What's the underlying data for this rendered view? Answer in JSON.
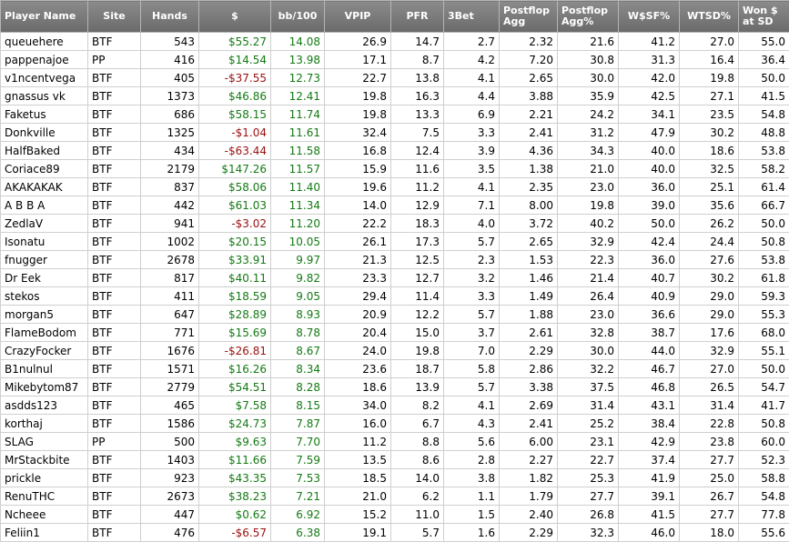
{
  "columns": [
    {
      "key": "name",
      "label": "Player Name",
      "cls": "left"
    },
    {
      "key": "site",
      "label": "Site",
      "cls": ""
    },
    {
      "key": "hands",
      "label": "Hands",
      "cls": ""
    },
    {
      "key": "money",
      "label": "$",
      "cls": ""
    },
    {
      "key": "bb100",
      "label": "bb/100",
      "cls": ""
    },
    {
      "key": "vpip",
      "label": "VPIP",
      "cls": ""
    },
    {
      "key": "pfr",
      "label": "PFR",
      "cls": ""
    },
    {
      "key": "threebet",
      "label": "3Bet",
      "cls": "left"
    },
    {
      "key": "pfagg",
      "label": "Postflop Agg",
      "cls": "wrap"
    },
    {
      "key": "pfaggpct",
      "label": "Postflop Agg%",
      "cls": "wrap"
    },
    {
      "key": "wsf",
      "label": "W$SF%",
      "cls": ""
    },
    {
      "key": "wtsd",
      "label": "WTSD%",
      "cls": ""
    },
    {
      "key": "wonsd",
      "label": "Won $ at SD",
      "cls": "wrap"
    }
  ],
  "rows": [
    {
      "name": "queuehere",
      "site": "BTF",
      "hands": "543",
      "money": "$55.27",
      "bb100": "14.08",
      "vpip": "26.9",
      "pfr": "14.7",
      "threebet": "2.7",
      "pfagg": "2.32",
      "pfaggpct": "21.6",
      "wsf": "41.2",
      "wtsd": "27.0",
      "wonsd": "55.0"
    },
    {
      "name": "pappenajoe",
      "site": "PP",
      "hands": "416",
      "money": "$14.54",
      "bb100": "13.98",
      "vpip": "17.1",
      "pfr": "8.7",
      "threebet": "4.2",
      "pfagg": "7.20",
      "pfaggpct": "30.8",
      "wsf": "31.3",
      "wtsd": "16.4",
      "wonsd": "36.4"
    },
    {
      "name": "v1ncentvega",
      "site": "BTF",
      "hands": "405",
      "money": "-$37.55",
      "bb100": "12.73",
      "vpip": "22.7",
      "pfr": "13.8",
      "threebet": "4.1",
      "pfagg": "2.65",
      "pfaggpct": "30.0",
      "wsf": "42.0",
      "wtsd": "19.8",
      "wonsd": "50.0"
    },
    {
      "name": "gnassus vk",
      "site": "BTF",
      "hands": "1373",
      "money": "$46.86",
      "bb100": "12.41",
      "vpip": "19.8",
      "pfr": "16.3",
      "threebet": "4.4",
      "pfagg": "3.88",
      "pfaggpct": "35.9",
      "wsf": "42.5",
      "wtsd": "27.1",
      "wonsd": "41.5"
    },
    {
      "name": "Faketus",
      "site": "BTF",
      "hands": "686",
      "money": "$58.15",
      "bb100": "11.74",
      "vpip": "19.8",
      "pfr": "13.3",
      "threebet": "6.9",
      "pfagg": "2.21",
      "pfaggpct": "24.2",
      "wsf": "34.1",
      "wtsd": "23.5",
      "wonsd": "54.8"
    },
    {
      "name": "Donkville",
      "site": "BTF",
      "hands": "1325",
      "money": "-$1.04",
      "bb100": "11.61",
      "vpip": "32.4",
      "pfr": "7.5",
      "threebet": "3.3",
      "pfagg": "2.41",
      "pfaggpct": "31.2",
      "wsf": "47.9",
      "wtsd": "30.2",
      "wonsd": "48.8"
    },
    {
      "name": "HalfBaked",
      "site": "BTF",
      "hands": "434",
      "money": "-$63.44",
      "bb100": "11.58",
      "vpip": "16.8",
      "pfr": "12.4",
      "threebet": "3.9",
      "pfagg": "4.36",
      "pfaggpct": "34.3",
      "wsf": "40.0",
      "wtsd": "18.6",
      "wonsd": "53.8"
    },
    {
      "name": "Coriace89",
      "site": "BTF",
      "hands": "2179",
      "money": "$147.26",
      "bb100": "11.57",
      "vpip": "15.9",
      "pfr": "11.6",
      "threebet": "3.5",
      "pfagg": "1.38",
      "pfaggpct": "21.0",
      "wsf": "40.0",
      "wtsd": "32.5",
      "wonsd": "58.2"
    },
    {
      "name": "AKAKAKAK",
      "site": "BTF",
      "hands": "837",
      "money": "$58.06",
      "bb100": "11.40",
      "vpip": "19.6",
      "pfr": "11.2",
      "threebet": "4.1",
      "pfagg": "2.35",
      "pfaggpct": "23.0",
      "wsf": "36.0",
      "wtsd": "25.1",
      "wonsd": "61.4"
    },
    {
      "name": "A B B A",
      "site": "BTF",
      "hands": "442",
      "money": "$61.03",
      "bb100": "11.34",
      "vpip": "14.0",
      "pfr": "12.9",
      "threebet": "7.1",
      "pfagg": "8.00",
      "pfaggpct": "19.8",
      "wsf": "39.0",
      "wtsd": "35.6",
      "wonsd": "66.7"
    },
    {
      "name": "ZedlaV",
      "site": "BTF",
      "hands": "941",
      "money": "-$3.02",
      "bb100": "11.20",
      "vpip": "22.2",
      "pfr": "18.3",
      "threebet": "4.0",
      "pfagg": "3.72",
      "pfaggpct": "40.2",
      "wsf": "50.0",
      "wtsd": "26.2",
      "wonsd": "50.0"
    },
    {
      "name": "Isonatu",
      "site": "BTF",
      "hands": "1002",
      "money": "$20.15",
      "bb100": "10.05",
      "vpip": "26.1",
      "pfr": "17.3",
      "threebet": "5.7",
      "pfagg": "2.65",
      "pfaggpct": "32.9",
      "wsf": "42.4",
      "wtsd": "24.4",
      "wonsd": "50.8"
    },
    {
      "name": "fnugger",
      "site": "BTF",
      "hands": "2678",
      "money": "$33.91",
      "bb100": "9.97",
      "vpip": "21.3",
      "pfr": "12.5",
      "threebet": "2.3",
      "pfagg": "1.53",
      "pfaggpct": "22.3",
      "wsf": "36.0",
      "wtsd": "27.6",
      "wonsd": "53.8"
    },
    {
      "name": "Dr Eek",
      "site": "BTF",
      "hands": "817",
      "money": "$40.11",
      "bb100": "9.82",
      "vpip": "23.3",
      "pfr": "12.7",
      "threebet": "3.2",
      "pfagg": "1.46",
      "pfaggpct": "21.4",
      "wsf": "40.7",
      "wtsd": "30.2",
      "wonsd": "61.8"
    },
    {
      "name": "stekos",
      "site": "BTF",
      "hands": "411",
      "money": "$18.59",
      "bb100": "9.05",
      "vpip": "29.4",
      "pfr": "11.4",
      "threebet": "3.3",
      "pfagg": "1.49",
      "pfaggpct": "26.4",
      "wsf": "40.9",
      "wtsd": "29.0",
      "wonsd": "59.3"
    },
    {
      "name": "morgan5",
      "site": "BTF",
      "hands": "647",
      "money": "$28.89",
      "bb100": "8.93",
      "vpip": "20.9",
      "pfr": "12.2",
      "threebet": "5.7",
      "pfagg": "1.88",
      "pfaggpct": "23.0",
      "wsf": "36.6",
      "wtsd": "29.0",
      "wonsd": "55.3"
    },
    {
      "name": "FlameBodom",
      "site": "BTF",
      "hands": "771",
      "money": "$15.69",
      "bb100": "8.78",
      "vpip": "20.4",
      "pfr": "15.0",
      "threebet": "3.7",
      "pfagg": "2.61",
      "pfaggpct": "32.8",
      "wsf": "38.7",
      "wtsd": "17.6",
      "wonsd": "68.0"
    },
    {
      "name": "CrazyFocker",
      "site": "BTF",
      "hands": "1676",
      "money": "-$26.81",
      "bb100": "8.67",
      "vpip": "24.0",
      "pfr": "19.8",
      "threebet": "7.0",
      "pfagg": "2.29",
      "pfaggpct": "30.0",
      "wsf": "44.0",
      "wtsd": "32.9",
      "wonsd": "55.1"
    },
    {
      "name": "B1nulnul",
      "site": "BTF",
      "hands": "1571",
      "money": "$16.26",
      "bb100": "8.34",
      "vpip": "23.6",
      "pfr": "18.7",
      "threebet": "5.8",
      "pfagg": "2.86",
      "pfaggpct": "32.2",
      "wsf": "46.7",
      "wtsd": "27.0",
      "wonsd": "50.0"
    },
    {
      "name": "Mikebytom87",
      "site": "BTF",
      "hands": "2779",
      "money": "$54.51",
      "bb100": "8.28",
      "vpip": "18.6",
      "pfr": "13.9",
      "threebet": "5.7",
      "pfagg": "3.38",
      "pfaggpct": "37.5",
      "wsf": "46.8",
      "wtsd": "26.5",
      "wonsd": "54.7"
    },
    {
      "name": "asdds123",
      "site": "BTF",
      "hands": "465",
      "money": "$7.58",
      "bb100": "8.15",
      "vpip": "34.0",
      "pfr": "8.2",
      "threebet": "4.1",
      "pfagg": "2.69",
      "pfaggpct": "31.4",
      "wsf": "43.1",
      "wtsd": "31.4",
      "wonsd": "41.7"
    },
    {
      "name": "korthaj",
      "site": "BTF",
      "hands": "1586",
      "money": "$24.73",
      "bb100": "7.87",
      "vpip": "16.0",
      "pfr": "6.7",
      "threebet": "4.3",
      "pfagg": "2.41",
      "pfaggpct": "25.2",
      "wsf": "38.4",
      "wtsd": "22.8",
      "wonsd": "50.8"
    },
    {
      "name": "SLAG",
      "site": "PP",
      "hands": "500",
      "money": "$9.63",
      "bb100": "7.70",
      "vpip": "11.2",
      "pfr": "8.8",
      "threebet": "5.6",
      "pfagg": "6.00",
      "pfaggpct": "23.1",
      "wsf": "42.9",
      "wtsd": "23.8",
      "wonsd": "60.0"
    },
    {
      "name": "MrStackbite",
      "site": "BTF",
      "hands": "1403",
      "money": "$11.66",
      "bb100": "7.59",
      "vpip": "13.5",
      "pfr": "8.6",
      "threebet": "2.8",
      "pfagg": "2.27",
      "pfaggpct": "22.7",
      "wsf": "37.4",
      "wtsd": "27.7",
      "wonsd": "52.3"
    },
    {
      "name": "prickle",
      "site": "BTF",
      "hands": "923",
      "money": "$43.35",
      "bb100": "7.53",
      "vpip": "18.5",
      "pfr": "14.0",
      "threebet": "3.8",
      "pfagg": "1.82",
      "pfaggpct": "25.3",
      "wsf": "41.9",
      "wtsd": "25.0",
      "wonsd": "58.8"
    },
    {
      "name": "RenuTHC",
      "site": "BTF",
      "hands": "2673",
      "money": "$38.23",
      "bb100": "7.21",
      "vpip": "21.0",
      "pfr": "6.2",
      "threebet": "1.1",
      "pfagg": "1.79",
      "pfaggpct": "27.7",
      "wsf": "39.1",
      "wtsd": "26.7",
      "wonsd": "54.8"
    },
    {
      "name": "Ncheee",
      "site": "BTF",
      "hands": "447",
      "money": "$0.62",
      "bb100": "6.92",
      "vpip": "15.2",
      "pfr": "11.0",
      "threebet": "1.5",
      "pfagg": "2.40",
      "pfaggpct": "26.8",
      "wsf": "41.5",
      "wtsd": "27.7",
      "wonsd": "77.8"
    },
    {
      "name": "Feliin1",
      "site": "BTF",
      "hands": "476",
      "money": "-$6.57",
      "bb100": "6.38",
      "vpip": "19.1",
      "pfr": "5.7",
      "threebet": "1.6",
      "pfagg": "2.29",
      "pfaggpct": "32.3",
      "wsf": "46.0",
      "wtsd": "18.0",
      "wonsd": "55.6"
    }
  ],
  "colors": {
    "positive": "#147a14",
    "negative": "#9a1010",
    "header_bg": "#7a7a7a"
  }
}
